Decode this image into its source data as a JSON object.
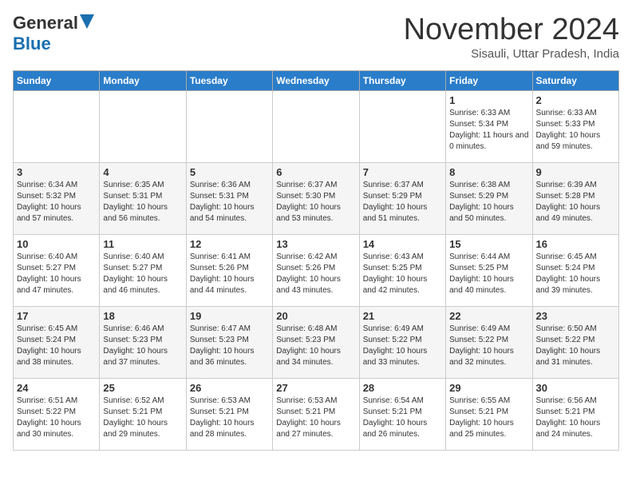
{
  "header": {
    "logo_general": "General",
    "logo_blue": "Blue",
    "month": "November 2024",
    "location": "Sisauli, Uttar Pradesh, India"
  },
  "weekdays": [
    "Sunday",
    "Monday",
    "Tuesday",
    "Wednesday",
    "Thursday",
    "Friday",
    "Saturday"
  ],
  "weeks": [
    [
      {
        "day": "",
        "info": ""
      },
      {
        "day": "",
        "info": ""
      },
      {
        "day": "",
        "info": ""
      },
      {
        "day": "",
        "info": ""
      },
      {
        "day": "",
        "info": ""
      },
      {
        "day": "1",
        "info": "Sunrise: 6:33 AM\nSunset: 5:34 PM\nDaylight: 11 hours and 0 minutes."
      },
      {
        "day": "2",
        "info": "Sunrise: 6:33 AM\nSunset: 5:33 PM\nDaylight: 10 hours and 59 minutes."
      }
    ],
    [
      {
        "day": "3",
        "info": "Sunrise: 6:34 AM\nSunset: 5:32 PM\nDaylight: 10 hours and 57 minutes."
      },
      {
        "day": "4",
        "info": "Sunrise: 6:35 AM\nSunset: 5:31 PM\nDaylight: 10 hours and 56 minutes."
      },
      {
        "day": "5",
        "info": "Sunrise: 6:36 AM\nSunset: 5:31 PM\nDaylight: 10 hours and 54 minutes."
      },
      {
        "day": "6",
        "info": "Sunrise: 6:37 AM\nSunset: 5:30 PM\nDaylight: 10 hours and 53 minutes."
      },
      {
        "day": "7",
        "info": "Sunrise: 6:37 AM\nSunset: 5:29 PM\nDaylight: 10 hours and 51 minutes."
      },
      {
        "day": "8",
        "info": "Sunrise: 6:38 AM\nSunset: 5:29 PM\nDaylight: 10 hours and 50 minutes."
      },
      {
        "day": "9",
        "info": "Sunrise: 6:39 AM\nSunset: 5:28 PM\nDaylight: 10 hours and 49 minutes."
      }
    ],
    [
      {
        "day": "10",
        "info": "Sunrise: 6:40 AM\nSunset: 5:27 PM\nDaylight: 10 hours and 47 minutes."
      },
      {
        "day": "11",
        "info": "Sunrise: 6:40 AM\nSunset: 5:27 PM\nDaylight: 10 hours and 46 minutes."
      },
      {
        "day": "12",
        "info": "Sunrise: 6:41 AM\nSunset: 5:26 PM\nDaylight: 10 hours and 44 minutes."
      },
      {
        "day": "13",
        "info": "Sunrise: 6:42 AM\nSunset: 5:26 PM\nDaylight: 10 hours and 43 minutes."
      },
      {
        "day": "14",
        "info": "Sunrise: 6:43 AM\nSunset: 5:25 PM\nDaylight: 10 hours and 42 minutes."
      },
      {
        "day": "15",
        "info": "Sunrise: 6:44 AM\nSunset: 5:25 PM\nDaylight: 10 hours and 40 minutes."
      },
      {
        "day": "16",
        "info": "Sunrise: 6:45 AM\nSunset: 5:24 PM\nDaylight: 10 hours and 39 minutes."
      }
    ],
    [
      {
        "day": "17",
        "info": "Sunrise: 6:45 AM\nSunset: 5:24 PM\nDaylight: 10 hours and 38 minutes."
      },
      {
        "day": "18",
        "info": "Sunrise: 6:46 AM\nSunset: 5:23 PM\nDaylight: 10 hours and 37 minutes."
      },
      {
        "day": "19",
        "info": "Sunrise: 6:47 AM\nSunset: 5:23 PM\nDaylight: 10 hours and 36 minutes."
      },
      {
        "day": "20",
        "info": "Sunrise: 6:48 AM\nSunset: 5:23 PM\nDaylight: 10 hours and 34 minutes."
      },
      {
        "day": "21",
        "info": "Sunrise: 6:49 AM\nSunset: 5:22 PM\nDaylight: 10 hours and 33 minutes."
      },
      {
        "day": "22",
        "info": "Sunrise: 6:49 AM\nSunset: 5:22 PM\nDaylight: 10 hours and 32 minutes."
      },
      {
        "day": "23",
        "info": "Sunrise: 6:50 AM\nSunset: 5:22 PM\nDaylight: 10 hours and 31 minutes."
      }
    ],
    [
      {
        "day": "24",
        "info": "Sunrise: 6:51 AM\nSunset: 5:22 PM\nDaylight: 10 hours and 30 minutes."
      },
      {
        "day": "25",
        "info": "Sunrise: 6:52 AM\nSunset: 5:21 PM\nDaylight: 10 hours and 29 minutes."
      },
      {
        "day": "26",
        "info": "Sunrise: 6:53 AM\nSunset: 5:21 PM\nDaylight: 10 hours and 28 minutes."
      },
      {
        "day": "27",
        "info": "Sunrise: 6:53 AM\nSunset: 5:21 PM\nDaylight: 10 hours and 27 minutes."
      },
      {
        "day": "28",
        "info": "Sunrise: 6:54 AM\nSunset: 5:21 PM\nDaylight: 10 hours and 26 minutes."
      },
      {
        "day": "29",
        "info": "Sunrise: 6:55 AM\nSunset: 5:21 PM\nDaylight: 10 hours and 25 minutes."
      },
      {
        "day": "30",
        "info": "Sunrise: 6:56 AM\nSunset: 5:21 PM\nDaylight: 10 hours and 24 minutes."
      }
    ]
  ]
}
